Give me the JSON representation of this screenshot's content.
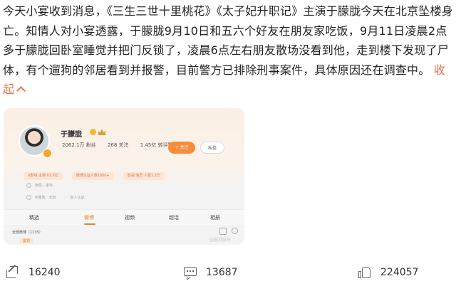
{
  "post": {
    "text": "今天小宴收到消息，《三生三世十里桃花》《太子妃升职记》主演于朦胧今天在北京坠楼身亡。知情人对小宴透露，于朦胧9月10日和五六个好友在朋友家吃饭，9月11日凌晨2点多于朦胧回卧室睡觉并把门反锁了，凌晨6点左右朋友散场没看到他，走到楼下发现了尸体，有个遛狗的邻居看到并报警，目前警方已排除刑事案件，具体原因还在调查中。",
    "collapse_label": "收起"
  },
  "card": {
    "nickname": "于朦胧",
    "stats": [
      "2062.1万 粉丝",
      "268 关注",
      "1.45亿 转评赞"
    ],
    "follow_label": "+ 关注",
    "message_label": "私信",
    "tags": [
      "V影响 主演 01.2亿",
      "微博认证人数1000+",
      "影视 演员 人数1.2万"
    ],
    "info_line1": "演员，歌手",
    "info_line2": "IP属地：北京　　　　本人认证　　　　",
    "tabs": [
      "精选",
      "微博",
      "视频",
      "超话",
      "相册"
    ],
    "all_weibo_label": "全部微博（1135）",
    "top_tag": "置顶",
    "watermark": "@鹿岛娱乐"
  },
  "toolbar": {
    "share_count": "16240",
    "comment_count": "13687",
    "like_count": "224057"
  },
  "colors": {
    "accent": "#eb7350",
    "tab_active": "#f07f2b"
  },
  "icons": [
    "chevron-up-icon",
    "share-icon",
    "comment-icon",
    "like-icon",
    "verified-icon",
    "crown-icon",
    "filter-icon",
    "search-icon"
  ]
}
